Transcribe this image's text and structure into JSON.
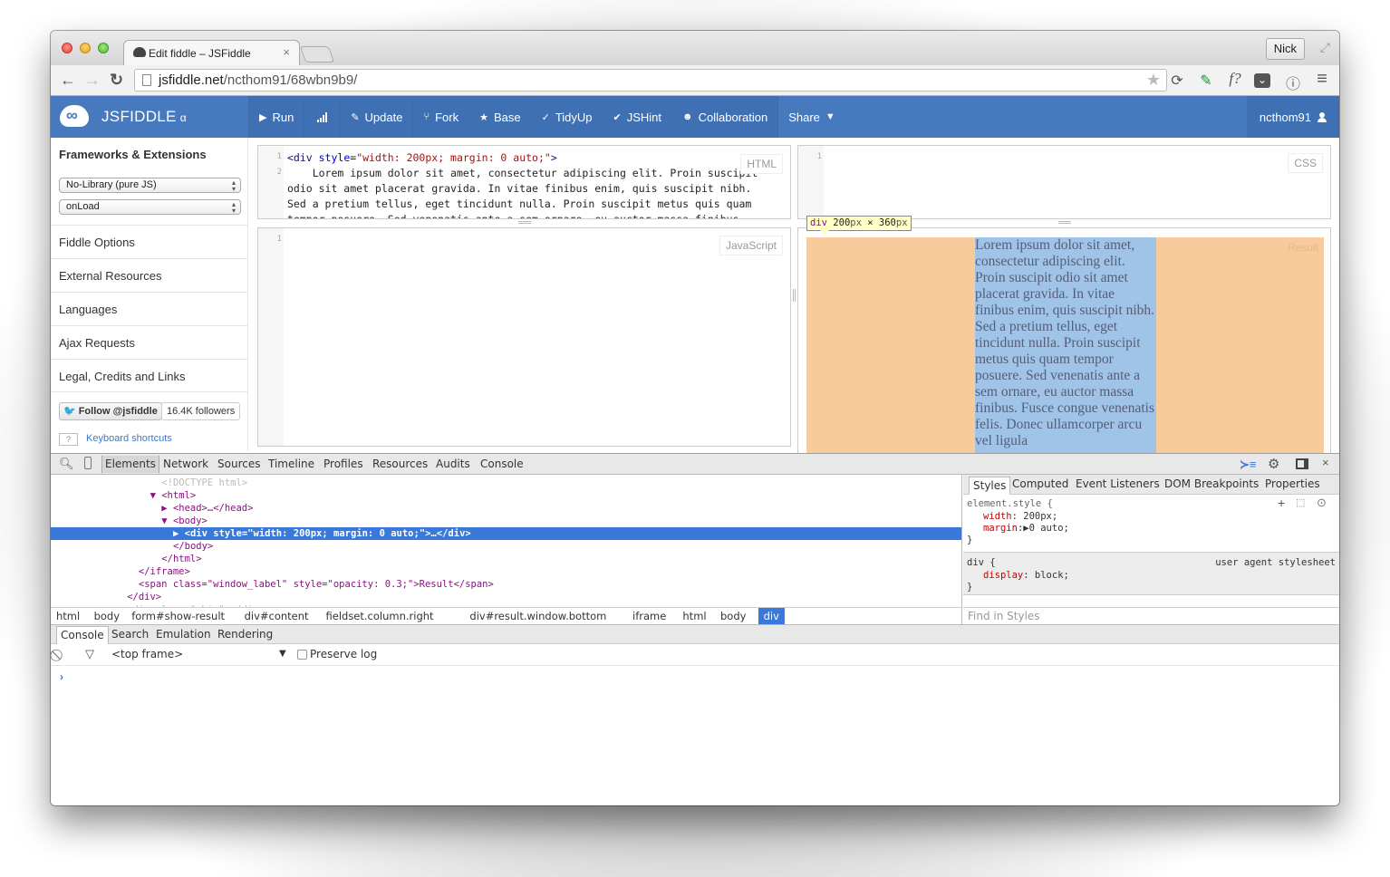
{
  "browser": {
    "tab_title": "Edit fiddle – JSFiddle",
    "tab_close": "×",
    "profile_name": "Nick",
    "url_host": "jsfiddle.net",
    "url_path": "/ncthom91/68wbn9b9/",
    "icons": {
      "back": "←",
      "forward": "→",
      "reload": "↻",
      "star": "★",
      "ext1": "⟳",
      "ext2": "✎",
      "ext3": "f?",
      "ext4": "⌄",
      "ext5": "ⓘ",
      "menu": "≡",
      "fullscreen": "⤢"
    }
  },
  "header": {
    "brand": "JSFIDDLE",
    "brand_suffix": "α",
    "menu": [
      {
        "icon": "▶",
        "label": "Run"
      },
      {
        "icon": "▮",
        "label": ""
      },
      {
        "icon": "✎",
        "label": "Update"
      },
      {
        "icon": "⑂",
        "label": "Fork"
      },
      {
        "icon": "★",
        "label": "Base"
      },
      {
        "icon": "✓",
        "label": "TidyUp"
      },
      {
        "icon": "✔",
        "label": "JSHint"
      },
      {
        "icon": "☻",
        "label": "Collaboration"
      },
      {
        "icon": "▼",
        "label": "Share"
      }
    ],
    "user": "ncthom91",
    "user_icon": "👤"
  },
  "sidebar": {
    "frameworks_title": "Frameworks & Extensions",
    "library_select": "No-Library (pure JS)",
    "load_select": "onLoad",
    "items": [
      {
        "label": "Fiddle Options"
      },
      {
        "label": "External Resources"
      },
      {
        "label": "Languages"
      },
      {
        "label": "Ajax Requests"
      },
      {
        "label": "Legal, Credits and Links"
      }
    ],
    "follow_label": "Follow @jsfiddle",
    "followers": "16.4K followers",
    "kbd_key": "?",
    "kbd_link": "Keyboard shortcuts"
  },
  "panels": {
    "html": {
      "label": "HTML",
      "line_numbers": [
        "1",
        "2"
      ],
      "code_tag_open": "<div",
      "code_attr": " style",
      "code_eq": "=",
      "code_str": "\"width: 200px; margin: 0 auto;\"",
      "code_close": ">",
      "code_body": "    Lorem ipsum dolor sit amet, consectetur adipiscing elit. Proin suscipit odio sit amet placerat gravida. In vitae finibus enim, quis suscipit nibh. Sed a pretium tellus, eget tincidunt nulla. Proin suscipit metus quis quam tempor posuere. Sed venenatis ante a sem ornare, eu auctor massa finibus."
    },
    "css": {
      "label": "CSS",
      "line_numbers": [
        "1"
      ]
    },
    "js": {
      "label": "JavaScript",
      "line_numbers": [
        "1"
      ]
    },
    "result": {
      "label": "Result",
      "text": "Lorem ipsum dolor sit amet, consectetur adipiscing elit. Proin suscipit odio sit amet placerat gravida. In vitae finibus enim, quis suscipit nibh. Sed a pretium tellus, eget tincidunt nulla. Proin suscipit metus quis quam tempor posuere. Sed venenatis ante a sem ornare, eu auctor massa finibus. Fusce congue venenatis felis. Donec ullamcorper arcu vel ligula"
    },
    "tooltip": {
      "tag": "div",
      "w": "200",
      "h": "360",
      "unit": "px",
      "x": "×"
    }
  },
  "devtools": {
    "tabs": [
      "Elements",
      "Network",
      "Sources",
      "Timeline",
      "Profiles",
      "Resources",
      "Audits",
      "Console"
    ],
    "active_tab": "Elements",
    "dom": [
      {
        "indent": 9,
        "text": "<!DOCTYPE html>",
        "kind": "doctype"
      },
      {
        "indent": 8,
        "text": "▼ <html>",
        "kind": "tag"
      },
      {
        "indent": 9,
        "text": "▶ <head>…</head>",
        "kind": "tag"
      },
      {
        "indent": 9,
        "text": "▼ <body>",
        "kind": "tag"
      },
      {
        "indent": 10,
        "text": "▶ <div style=\"width: 200px; margin: 0 auto;\">…</div>",
        "kind": "selected"
      },
      {
        "indent": 10,
        "text": "</body>",
        "kind": "tag"
      },
      {
        "indent": 9,
        "text": "</html>",
        "kind": "tag"
      },
      {
        "indent": 7,
        "text": "</iframe>",
        "kind": "tag"
      },
      {
        "indent": 7,
        "text": "<span class=\"window_label\" style=\"opacity: 0.3;\">Result</span>",
        "kind": "span"
      },
      {
        "indent": 6,
        "text": "</div>",
        "kind": "tag"
      },
      {
        "indent": 6,
        "text": "<div class=\"shim\"></div>",
        "kind": "dim"
      }
    ],
    "breadcrumbs": [
      "html",
      "body",
      "form#show-result",
      "div#content",
      "fieldset.column.right",
      "div#result.window.bottom",
      "iframe",
      "html",
      "body",
      "div"
    ],
    "styles_tabs": [
      "Styles",
      "Computed",
      "Event Listeners",
      "DOM Breakpoints",
      "Properties"
    ],
    "styles": {
      "element_selector": "element.style {",
      "rule1_prop": "width",
      "rule1_val": ": 200px;",
      "rule2_prop": "margin",
      "rule2_val": ":▶0 auto;",
      "close": "}",
      "ua_selector": "div {",
      "ua_source": "user agent stylesheet",
      "ua_prop": "display",
      "ua_val": ": block;",
      "find_placeholder": "Find in Styles"
    },
    "drawer_tabs": [
      "Console",
      "Search",
      "Emulation",
      "Rendering"
    ],
    "console": {
      "frame_select": "<top frame>",
      "preserve_log": "Preserve log",
      "prompt": "›"
    }
  }
}
